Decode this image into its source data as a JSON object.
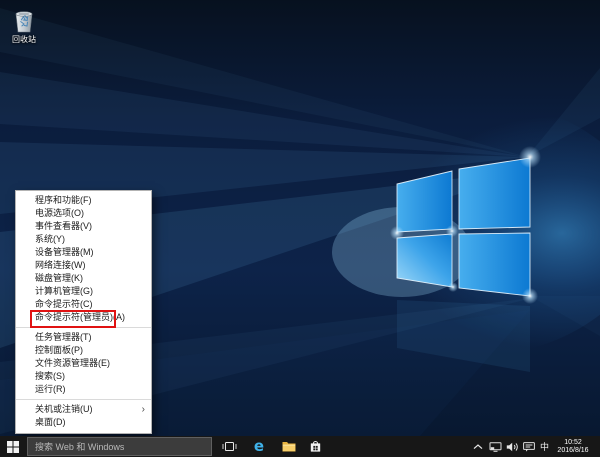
{
  "desktop": {
    "icons": [
      {
        "name": "recycle-bin",
        "label": "回收站"
      }
    ]
  },
  "context_menu": {
    "items": [
      {
        "label": "程序和功能(F)"
      },
      {
        "label": "电源选项(O)"
      },
      {
        "label": "事件查看器(V)"
      },
      {
        "label": "系统(Y)"
      },
      {
        "label": "设备管理器(M)"
      },
      {
        "label": "网络连接(W)"
      },
      {
        "label": "磁盘管理(K)"
      },
      {
        "label": "计算机管理(G)"
      },
      {
        "label": "命令提示符(C)"
      },
      {
        "label": "命令提示符(管理员)(A)",
        "highlighted": true
      },
      {
        "separator": true
      },
      {
        "label": "任务管理器(T)"
      },
      {
        "label": "控制面板(P)"
      },
      {
        "label": "文件资源管理器(E)"
      },
      {
        "label": "搜索(S)"
      },
      {
        "label": "运行(R)"
      },
      {
        "separator": true
      },
      {
        "label": "关机或注销(U)",
        "submenu": true
      },
      {
        "label": "桌面(D)"
      }
    ]
  },
  "taskbar": {
    "search": {
      "placeholder": "搜索 Web 和 Windows"
    },
    "app_icons": [
      "windows-start",
      "task-view",
      "edge",
      "file-explorer",
      "store"
    ],
    "tray": {
      "icons": [
        "expand-chevron",
        "network",
        "volume",
        "message"
      ],
      "ime_indicator": "中",
      "time": "10:52",
      "date": "2016/8/16"
    }
  },
  "colors": {
    "highlight_box": "#e01212",
    "taskbar_bg": "#171717",
    "menu_bg": "#ffffff",
    "menu_text": "#1b1b1b",
    "wallpaper_dark_blue": "#0b1d3d",
    "wallpaper_pane_blue": "#0d7ad0",
    "edge_blue": "#3fb2ea",
    "folder_yellow": "#f7cf6a"
  }
}
